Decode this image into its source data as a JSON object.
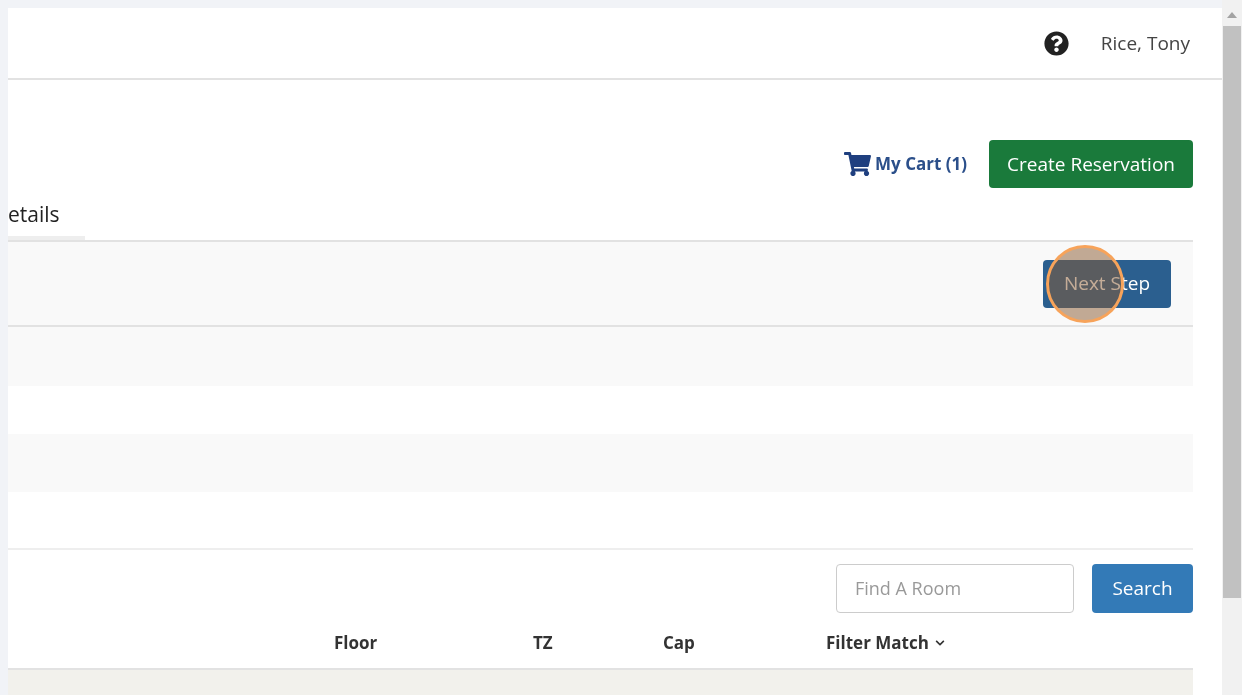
{
  "header": {
    "user": "Rice, Tony"
  },
  "toolbar": {
    "cart": "My Cart (1)",
    "create_button": "Create Reservation"
  },
  "tabs": [
    {
      "label": "etails"
    }
  ],
  "step_bar": {
    "next_button": "Next Step"
  },
  "search": {
    "placeholder": "Find A Room",
    "button": "Search"
  },
  "table": {
    "columns": [
      {
        "label": "Floor",
        "kind": "plain"
      },
      {
        "label": "TZ",
        "kind": "plain"
      },
      {
        "label": "Cap",
        "kind": "plain"
      },
      {
        "label": "Filter Match",
        "kind": "dropdown"
      }
    ]
  }
}
